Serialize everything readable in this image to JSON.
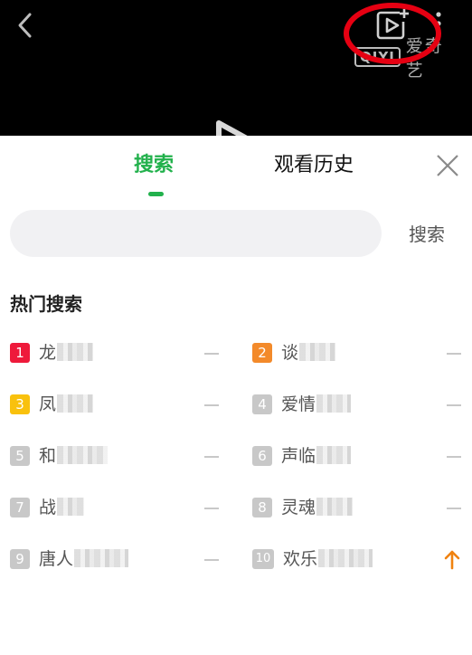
{
  "header": {
    "icons": {
      "back": "chevron-left-icon",
      "add_video": "add-video-icon",
      "more": "more-vertical-icon"
    },
    "logo_mark": "QIYI",
    "logo_text": "爱奇艺",
    "highlight_color": "#e60012"
  },
  "tabs": [
    {
      "label": "搜索",
      "active": true
    },
    {
      "label": "观看历史",
      "active": false
    }
  ],
  "colors": {
    "accent": "#22b14c",
    "rank1": "#ee1a3b",
    "rank2": "#f38a2a",
    "rank3": "#f9c10d",
    "rank_other": "#c8c8c8",
    "trend_up": "#f0820f"
  },
  "search": {
    "value": "",
    "placeholder": "",
    "button_label": "搜索"
  },
  "hot": {
    "title": "热门搜索",
    "items": [
      {
        "rank": "1",
        "text": "龙",
        "trend": "flat"
      },
      {
        "rank": "2",
        "text": "谈",
        "trend": "flat"
      },
      {
        "rank": "3",
        "text": "凤",
        "trend": "flat"
      },
      {
        "rank": "4",
        "text": "爱情",
        "trend": "flat"
      },
      {
        "rank": "5",
        "text": "和",
        "trend": "flat"
      },
      {
        "rank": "6",
        "text": "声临",
        "trend": "flat"
      },
      {
        "rank": "7",
        "text": "战",
        "trend": "flat"
      },
      {
        "rank": "8",
        "text": "灵魂",
        "trend": "flat"
      },
      {
        "rank": "9",
        "text": "唐人",
        "trend": "flat"
      },
      {
        "rank": "10",
        "text": "欢乐",
        "trend": "up"
      }
    ]
  }
}
